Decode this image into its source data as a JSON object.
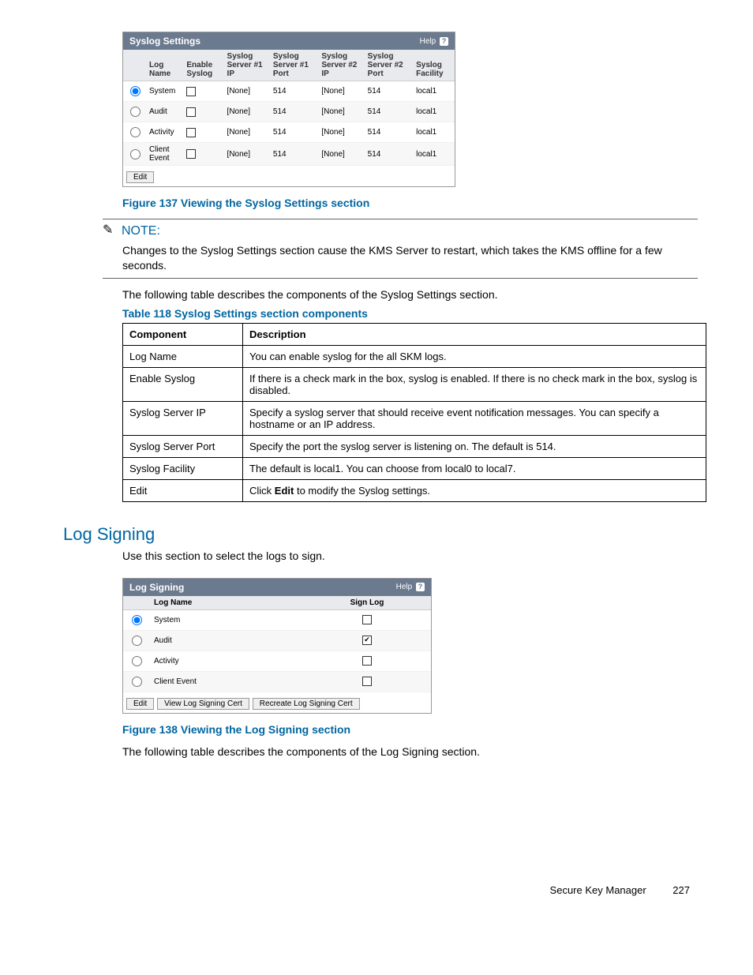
{
  "syslog_panel": {
    "title": "Syslog Settings",
    "help": "Help",
    "headers": [
      "",
      "Log Name",
      "Enable Syslog",
      "Syslog Server #1 IP",
      "Syslog Server #1 Port",
      "Syslog Server #2 IP",
      "Syslog Server #2 Port",
      "Syslog Facility"
    ],
    "rows": [
      {
        "selected": true,
        "name": "System",
        "enabled": false,
        "s1ip": "[None]",
        "s1port": "514",
        "s2ip": "[None]",
        "s2port": "514",
        "facility": "local1"
      },
      {
        "selected": false,
        "name": "Audit",
        "enabled": false,
        "s1ip": "[None]",
        "s1port": "514",
        "s2ip": "[None]",
        "s2port": "514",
        "facility": "local1"
      },
      {
        "selected": false,
        "name": "Activity",
        "enabled": false,
        "s1ip": "[None]",
        "s1port": "514",
        "s2ip": "[None]",
        "s2port": "514",
        "facility": "local1"
      },
      {
        "selected": false,
        "name": "Client Event",
        "enabled": false,
        "s1ip": "[None]",
        "s1port": "514",
        "s2ip": "[None]",
        "s2port": "514",
        "facility": "local1"
      }
    ],
    "edit": "Edit"
  },
  "figure137": "Figure 137 Viewing the Syslog Settings section",
  "note_label": "NOTE:",
  "note_text": "Changes to the Syslog Settings section cause the KMS Server to restart, which takes the KMS offline for a few seconds.",
  "intro_text": "The following table describes the components of the Syslog Settings section.",
  "table118_caption": "Table 118 Syslog Settings section components",
  "table118": {
    "headers": [
      "Component",
      "Description"
    ],
    "rows": [
      {
        "c": "Log Name",
        "d": "You can enable syslog for the all SKM logs."
      },
      {
        "c": "Enable Syslog",
        "d": "If there is a check mark in the box, syslog is enabled. If there is no check mark in the box, syslog is disabled."
      },
      {
        "c": "Syslog Server IP",
        "d": "Specify a syslog server that should receive event notification messages. You can specify a hostname or an IP address."
      },
      {
        "c": "Syslog Server Port",
        "d": "Specify the port the syslog server is listening on. The default is 514."
      },
      {
        "c": "Syslog Facility",
        "d": "The default is local1. You can choose from local0 to local7."
      },
      {
        "c": "Edit",
        "d_pre": "Click ",
        "d_bold": "Edit",
        "d_post": " to modify the Syslog settings."
      }
    ]
  },
  "section_heading": "Log Signing",
  "section_intro": "Use this section to select the logs to sign.",
  "logsigning_panel": {
    "title": "Log Signing",
    "help": "Help",
    "headers": [
      "",
      "Log Name",
      "Sign Log"
    ],
    "rows": [
      {
        "selected": true,
        "name": "System",
        "sign": false
      },
      {
        "selected": false,
        "name": "Audit",
        "sign": true
      },
      {
        "selected": false,
        "name": "Activity",
        "sign": false
      },
      {
        "selected": false,
        "name": "Client Event",
        "sign": false
      }
    ],
    "buttons": [
      "Edit",
      "View Log Signing Cert",
      "Recreate Log Signing Cert"
    ]
  },
  "figure138": "Figure 138 Viewing the Log Signing section",
  "after138": "The following table describes the components of the Log Signing section.",
  "footer_title": "Secure Key Manager",
  "footer_page": "227"
}
